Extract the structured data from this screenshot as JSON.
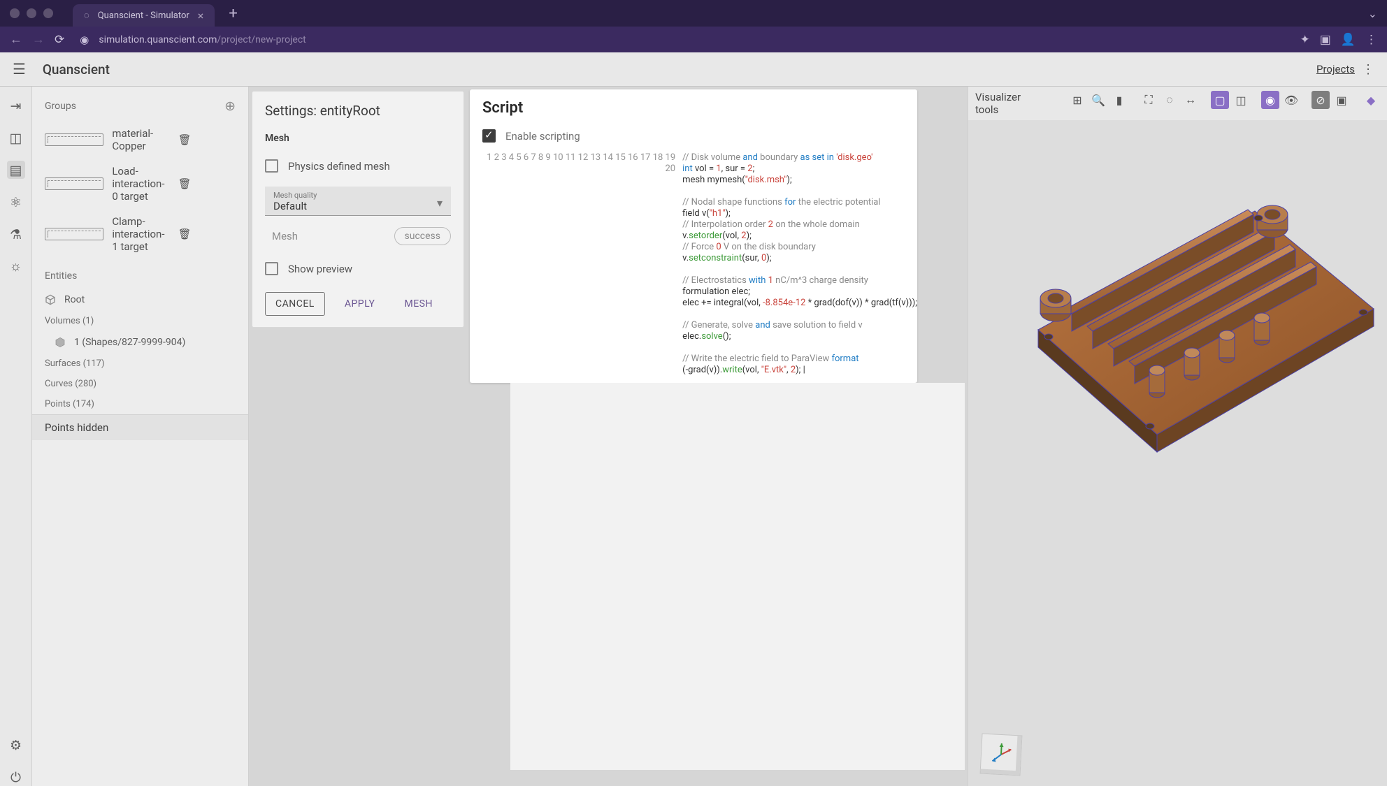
{
  "browser": {
    "tab_title": "Quanscient - Simulator",
    "url_host": "simulation.quanscient.com",
    "url_path": "/project/new-project"
  },
  "header": {
    "app_name": "Quanscient",
    "projects_link": "Projects"
  },
  "groups": {
    "heading": "Groups",
    "items": [
      {
        "label": "material-Copper"
      },
      {
        "label": "Load-interaction-0 target"
      },
      {
        "label": "Clamp-interaction-1 target"
      }
    ],
    "entities_heading": "Entities",
    "root": "Root",
    "volumes": "Volumes (1)",
    "vol_item": "1 (Shapes/827-9999-904)",
    "surfaces": "Surfaces (117)",
    "curves": "Curves (280)",
    "points": "Points (174)",
    "points_hidden": "Points hidden"
  },
  "settings": {
    "title": "Settings: entityRoot",
    "mesh_label": "Mesh",
    "physics_mesh": "Physics defined mesh",
    "dd_label": "Mesh quality",
    "dd_value": "Default",
    "mesh_text": "Mesh",
    "mesh_status": "success",
    "show_preview": "Show preview",
    "btn_cancel": "CANCEL",
    "btn_apply": "APPLY",
    "btn_mesh": "MESH"
  },
  "script": {
    "title": "Script",
    "enable": "Enable scripting"
  },
  "viz": {
    "label": "Visualizer tools"
  }
}
